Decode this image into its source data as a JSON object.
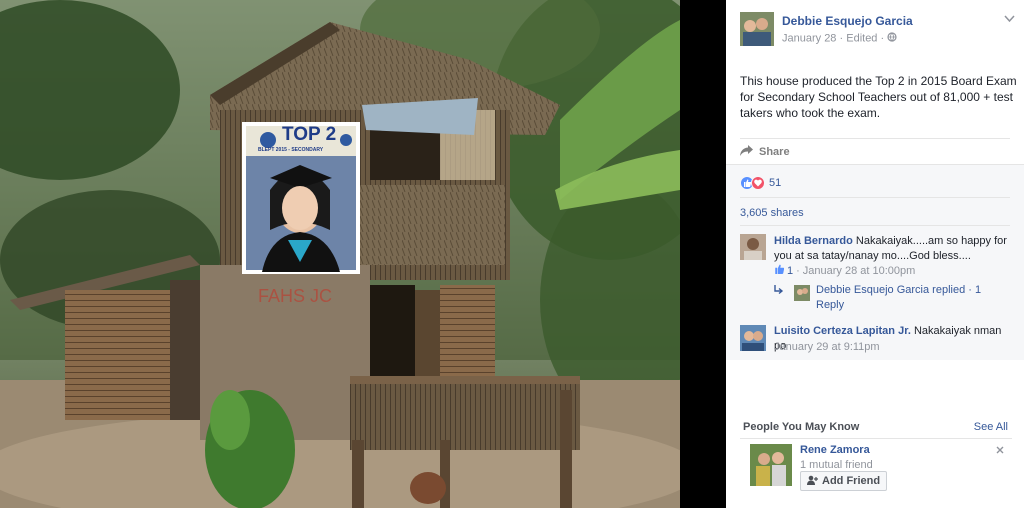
{
  "post": {
    "author": "Debbie Esquejo Garcia",
    "date": "January 28",
    "edited": "Edited",
    "privacy_icon": "globe-icon",
    "text": "This house produced the Top 2 in 2015 Board Exam for Secondary School Teachers out of 81,000 + test takers who took the exam."
  },
  "photo": {
    "banner_title": "TOP 2",
    "banner_subtitle": "BLEPT 2015 - SECONDARY"
  },
  "actions": {
    "share_label": "Share"
  },
  "stats": {
    "reaction_icons": [
      "like-icon",
      "love-icon"
    ],
    "reactions_count": "51",
    "shares_label": "3,605 shares"
  },
  "comments": [
    {
      "name": "Hilda Bernardo",
      "text": "Nakakaiyak.....am so happy for you at sa tatay/nanay mo....God bless....",
      "likes": "1",
      "time": "January 28 at 10:00pm",
      "reply_summary": "Debbie Esquejo Garcia replied · 1 Reply"
    },
    {
      "name": "Luisito Certeza Lapitan Jr.",
      "text": "Nakakaiyak nman po",
      "time": "January 29 at 9:11pm"
    }
  ],
  "pymk": {
    "title": "People You May Know",
    "see_all": "See All",
    "name": "Rene Zamora",
    "mutual": "1 mutual friend",
    "add_friend": "Add Friend"
  },
  "colors": {
    "link": "#365899",
    "muted": "#90949c",
    "like": "#5890ff",
    "love": "#f25268"
  }
}
